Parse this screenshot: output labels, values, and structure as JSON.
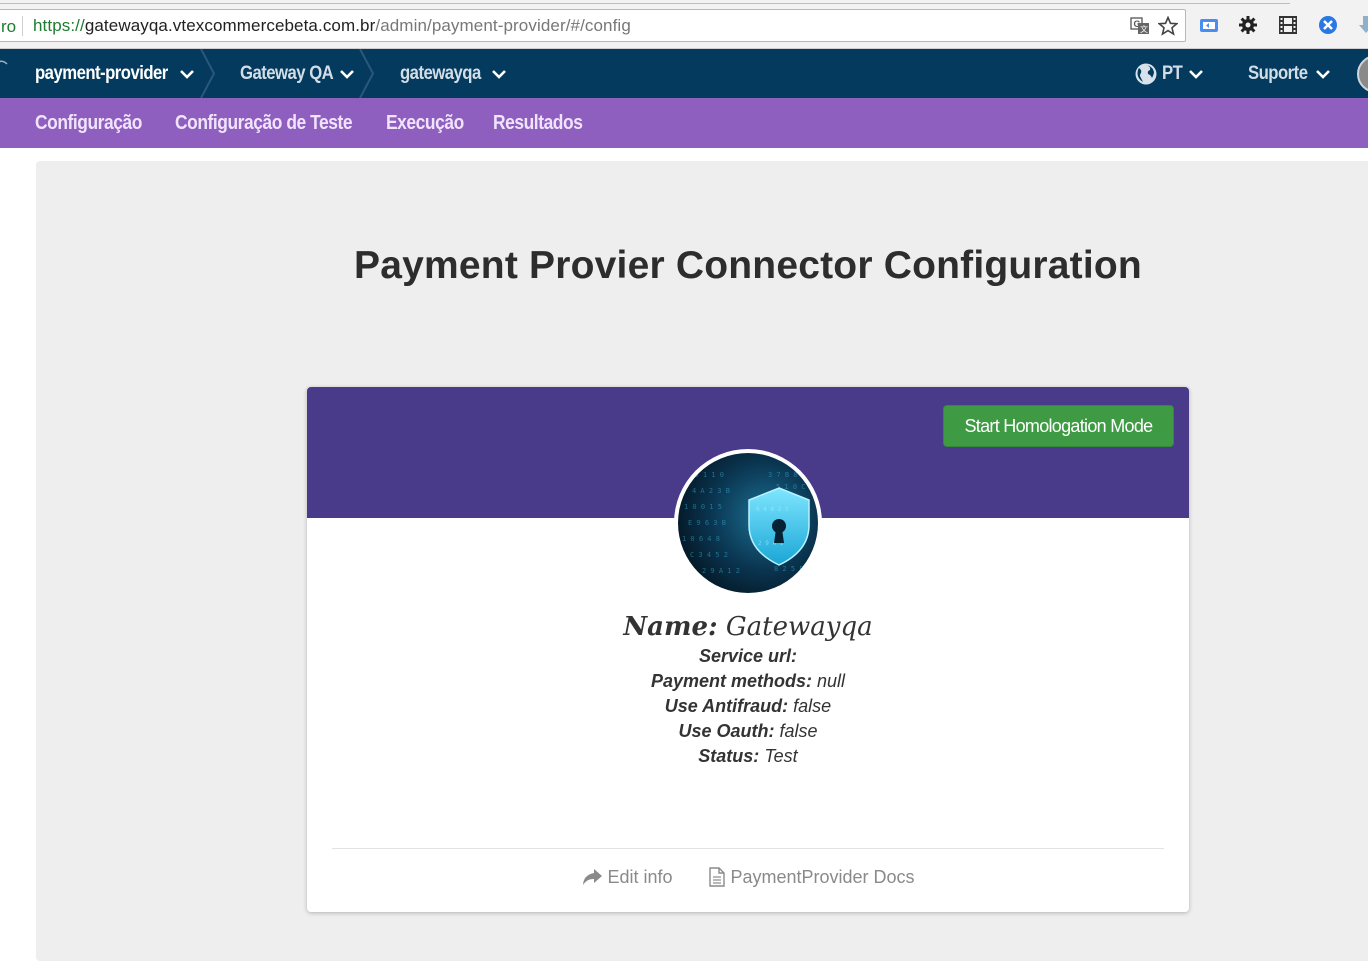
{
  "browser": {
    "left_fragment": "ro",
    "url_scheme": "https://",
    "url_host": "gatewayqa.vtexcommercebeta.com.br",
    "url_path": "/admin/payment-provider/#/config"
  },
  "topnav": {
    "app": "payment-provider",
    "account": "Gateway QA",
    "store": "gatewayqa",
    "language": "PT",
    "support": "Suporte"
  },
  "subnav": {
    "items": [
      "Configuração",
      "Configuração de Teste",
      "Execução",
      "Resultados"
    ]
  },
  "page": {
    "title": "Payment Provier Connector Configuration"
  },
  "card": {
    "homologation_button": "Start Homologation Mode",
    "name_label": "Name:",
    "name_value": "Gatewayqa",
    "service_url_label": "Service url:",
    "service_url_value": "",
    "payment_methods_label": "Payment methods:",
    "payment_methods_value": "null",
    "antifraud_label": "Use Antifraud:",
    "antifraud_value": "false",
    "oauth_label": "Use Oauth:",
    "oauth_value": "false",
    "status_label": "Status:",
    "status_value": "Test",
    "edit_info": "Edit info",
    "docs": "PaymentProvider Docs"
  },
  "colors": {
    "topnav_bg": "#033a5e",
    "subnav_bg": "#8f5fc0",
    "card_header_bg": "#4a3a8a",
    "primary_button": "#3e9b43"
  }
}
